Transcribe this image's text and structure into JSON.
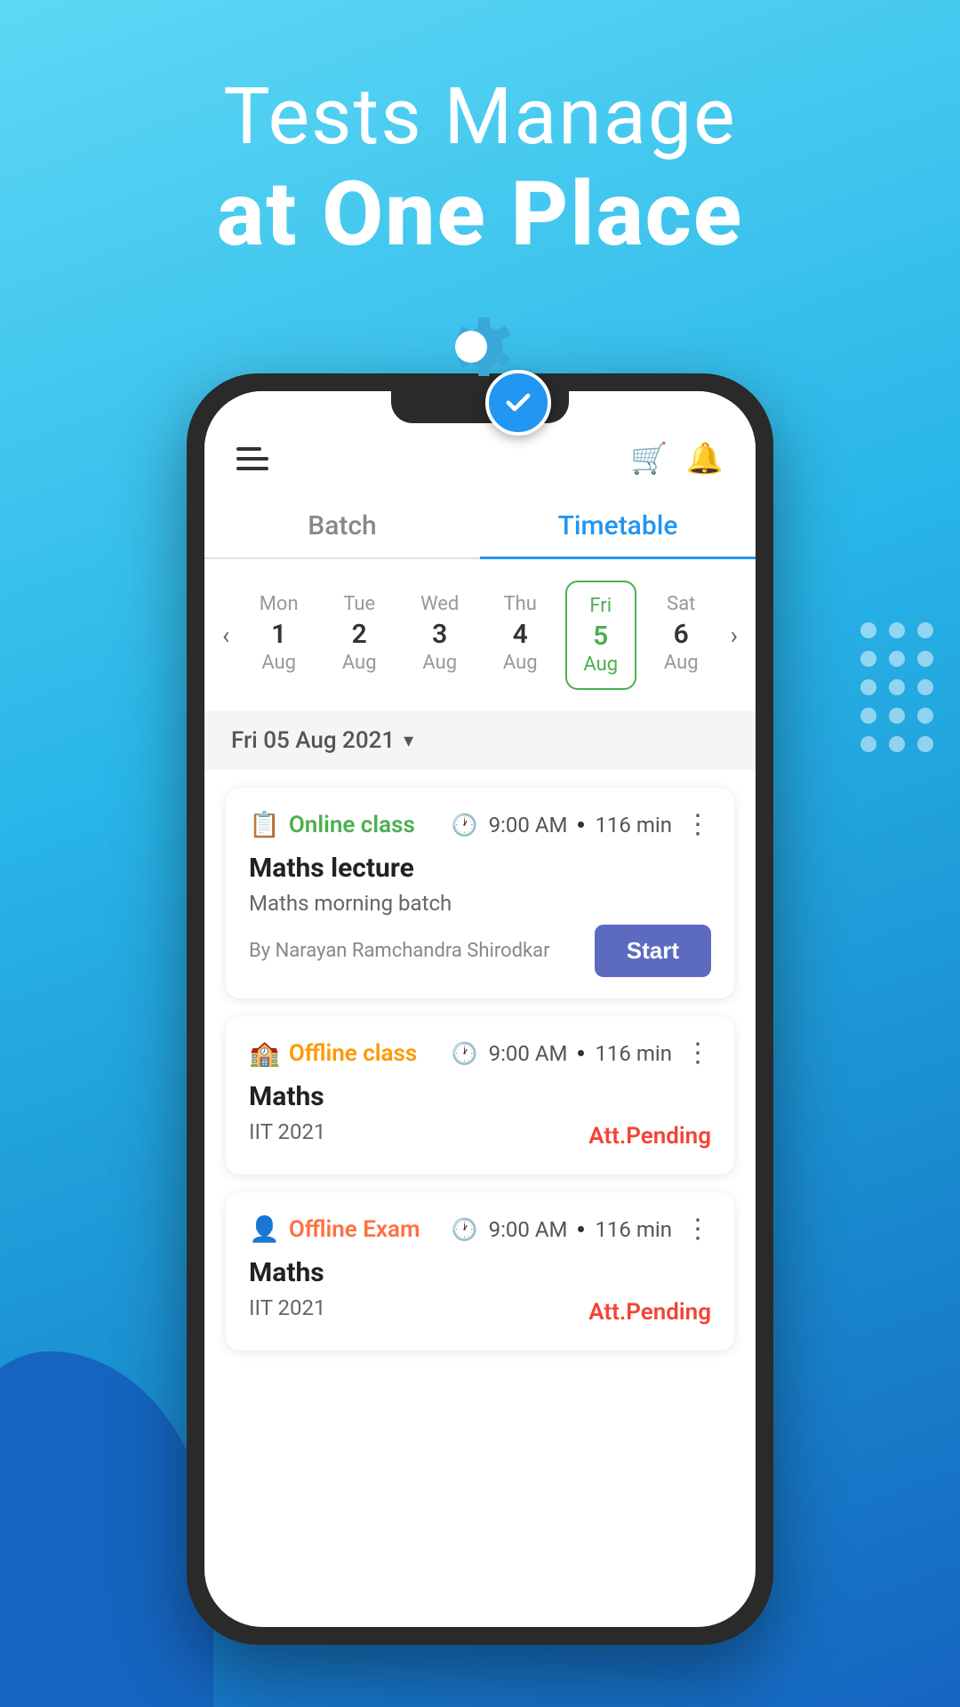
{
  "hero": {
    "line1": "Tests Manage",
    "line2": "at One Place"
  },
  "tabs": [
    {
      "id": "batch",
      "label": "Batch",
      "active": false
    },
    {
      "id": "timetable",
      "label": "Timetable",
      "active": true
    }
  ],
  "calendar": {
    "prev_arrow": "‹",
    "next_arrow": "›",
    "selected_date_label": "Fri 05 Aug 2021",
    "days": [
      {
        "name": "Mon",
        "num": "1",
        "month": "Aug",
        "active": false
      },
      {
        "name": "Tue",
        "num": "2",
        "month": "Aug",
        "active": false
      },
      {
        "name": "Wed",
        "num": "3",
        "month": "Aug",
        "active": false
      },
      {
        "name": "Thu",
        "num": "4",
        "month": "Aug",
        "active": false
      },
      {
        "name": "Fri",
        "num": "5",
        "month": "Aug",
        "active": true
      },
      {
        "name": "Sat",
        "num": "6",
        "month": "Aug",
        "active": false
      }
    ]
  },
  "cards": [
    {
      "type": "online",
      "type_label": "Online class",
      "type_icon": "📋",
      "time": "9:00 AM",
      "duration": "116 min",
      "title": "Maths lecture",
      "subtitle": "Maths morning batch",
      "author": "By Narayan Ramchandra  Shirodkar",
      "action": "start",
      "action_label": "Start",
      "status": ""
    },
    {
      "type": "offline",
      "type_label": "Offline class",
      "type_icon": "🏫",
      "time": "9:00 AM",
      "duration": "116 min",
      "title": "Maths",
      "subtitle": "IIT 2021",
      "author": "",
      "action": "status",
      "action_label": "Att.Pending",
      "status": "Att.Pending"
    },
    {
      "type": "exam",
      "type_label": "Offline Exam",
      "type_icon": "👤",
      "time": "9:00 AM",
      "duration": "116 min",
      "title": "Maths",
      "subtitle": "IIT 2021",
      "author": "",
      "action": "status",
      "action_label": "Att.Pending",
      "status": "Att.Pending"
    }
  ],
  "header": {
    "cart_icon": "🛒",
    "bell_icon": "🔔"
  }
}
